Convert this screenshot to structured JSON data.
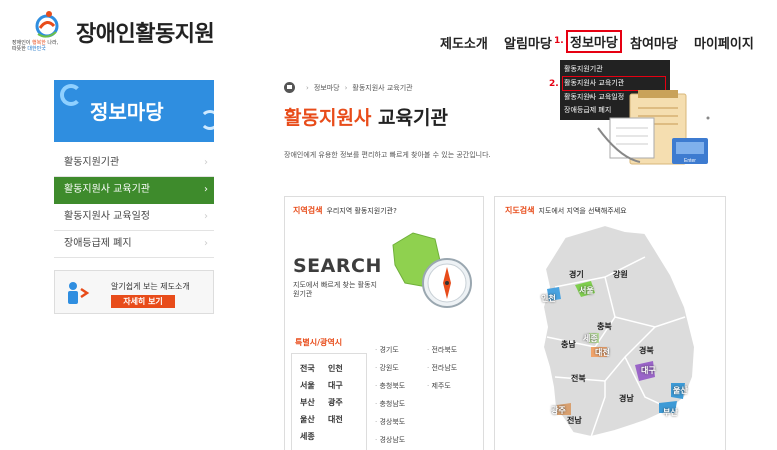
{
  "header": {
    "logo_title": "장애인활동지원",
    "logo_sub_line1_a": "장애인이 ",
    "logo_sub_line1_b": "행복한",
    "logo_sub_line1_c": " 나라,",
    "logo_sub_line2_a": "따뜻한 ",
    "logo_sub_line2_b": "대한민국",
    "gnb": [
      "제도소개",
      "알림마당",
      "정보마당",
      "참여마당",
      "마이페이지"
    ],
    "step1": "1.",
    "step2": "2."
  },
  "dropdown": {
    "items": [
      "활동지원기관",
      "활동지원사 교육기관",
      "활동지원사 교육일정",
      "장애등급제 폐지"
    ]
  },
  "sidebar": {
    "hero_title": "정보마당",
    "items": [
      "활동지원기관",
      "활동지원사 교육기관",
      "활동지원사 교육일정",
      "장애등급제 폐지"
    ],
    "active_index": 1,
    "banner_text": "알기쉽게 보는 제도소개",
    "banner_button": "자세히 보기"
  },
  "content": {
    "breadcrumb": [
      "정보마당",
      "활동지원사 교육기관"
    ],
    "title_accent": "활동지원사",
    "title_rest": " 교육기관",
    "description": "장애인에게 유용한 정보를 편리하고 빠르게 찾아볼 수 있는 공간입니다."
  },
  "region_search": {
    "head_title": "지역검색",
    "head_desc": "우리지역 활동지원기관?",
    "search_word": "SEARCH",
    "search_desc": "지도에서 빠르게 찾는 활동지원기관",
    "metro_title": "특별시/광역시",
    "metros": [
      "전국",
      "인천",
      "서울",
      "대구",
      "부산",
      "광주",
      "울산",
      "대전",
      "세종"
    ],
    "provinces": [
      "경기도",
      "전라북도",
      "강원도",
      "전라남도",
      "충청북도",
      "제주도",
      "충청남도",
      "",
      "경상북도",
      "",
      "경상남도",
      ""
    ]
  },
  "map_search": {
    "head_title": "지도검색",
    "head_desc": "지도에서 지역을 선택해주세요",
    "labels": {
      "gyeonggi": "경기",
      "gangwon": "강원",
      "seoul": "서울",
      "incheon": "인천",
      "chungbuk": "충북",
      "chungnam": "충남",
      "sejong": "세종",
      "daejeon": "대전",
      "gyeongbuk": "경북",
      "jeonbuk": "전북",
      "daegu": "대구",
      "gyeongnam": "경남",
      "ulsan": "울산",
      "busan": "부산",
      "gwangju": "광주",
      "jeonnam": "전남"
    }
  },
  "colors": {
    "accent_orange": "#e84c1a",
    "highlight_red": "#e60012",
    "sidebar_blue": "#2f8ee0",
    "active_green": "#3e8b2c",
    "dropdown_bg": "#222222"
  }
}
